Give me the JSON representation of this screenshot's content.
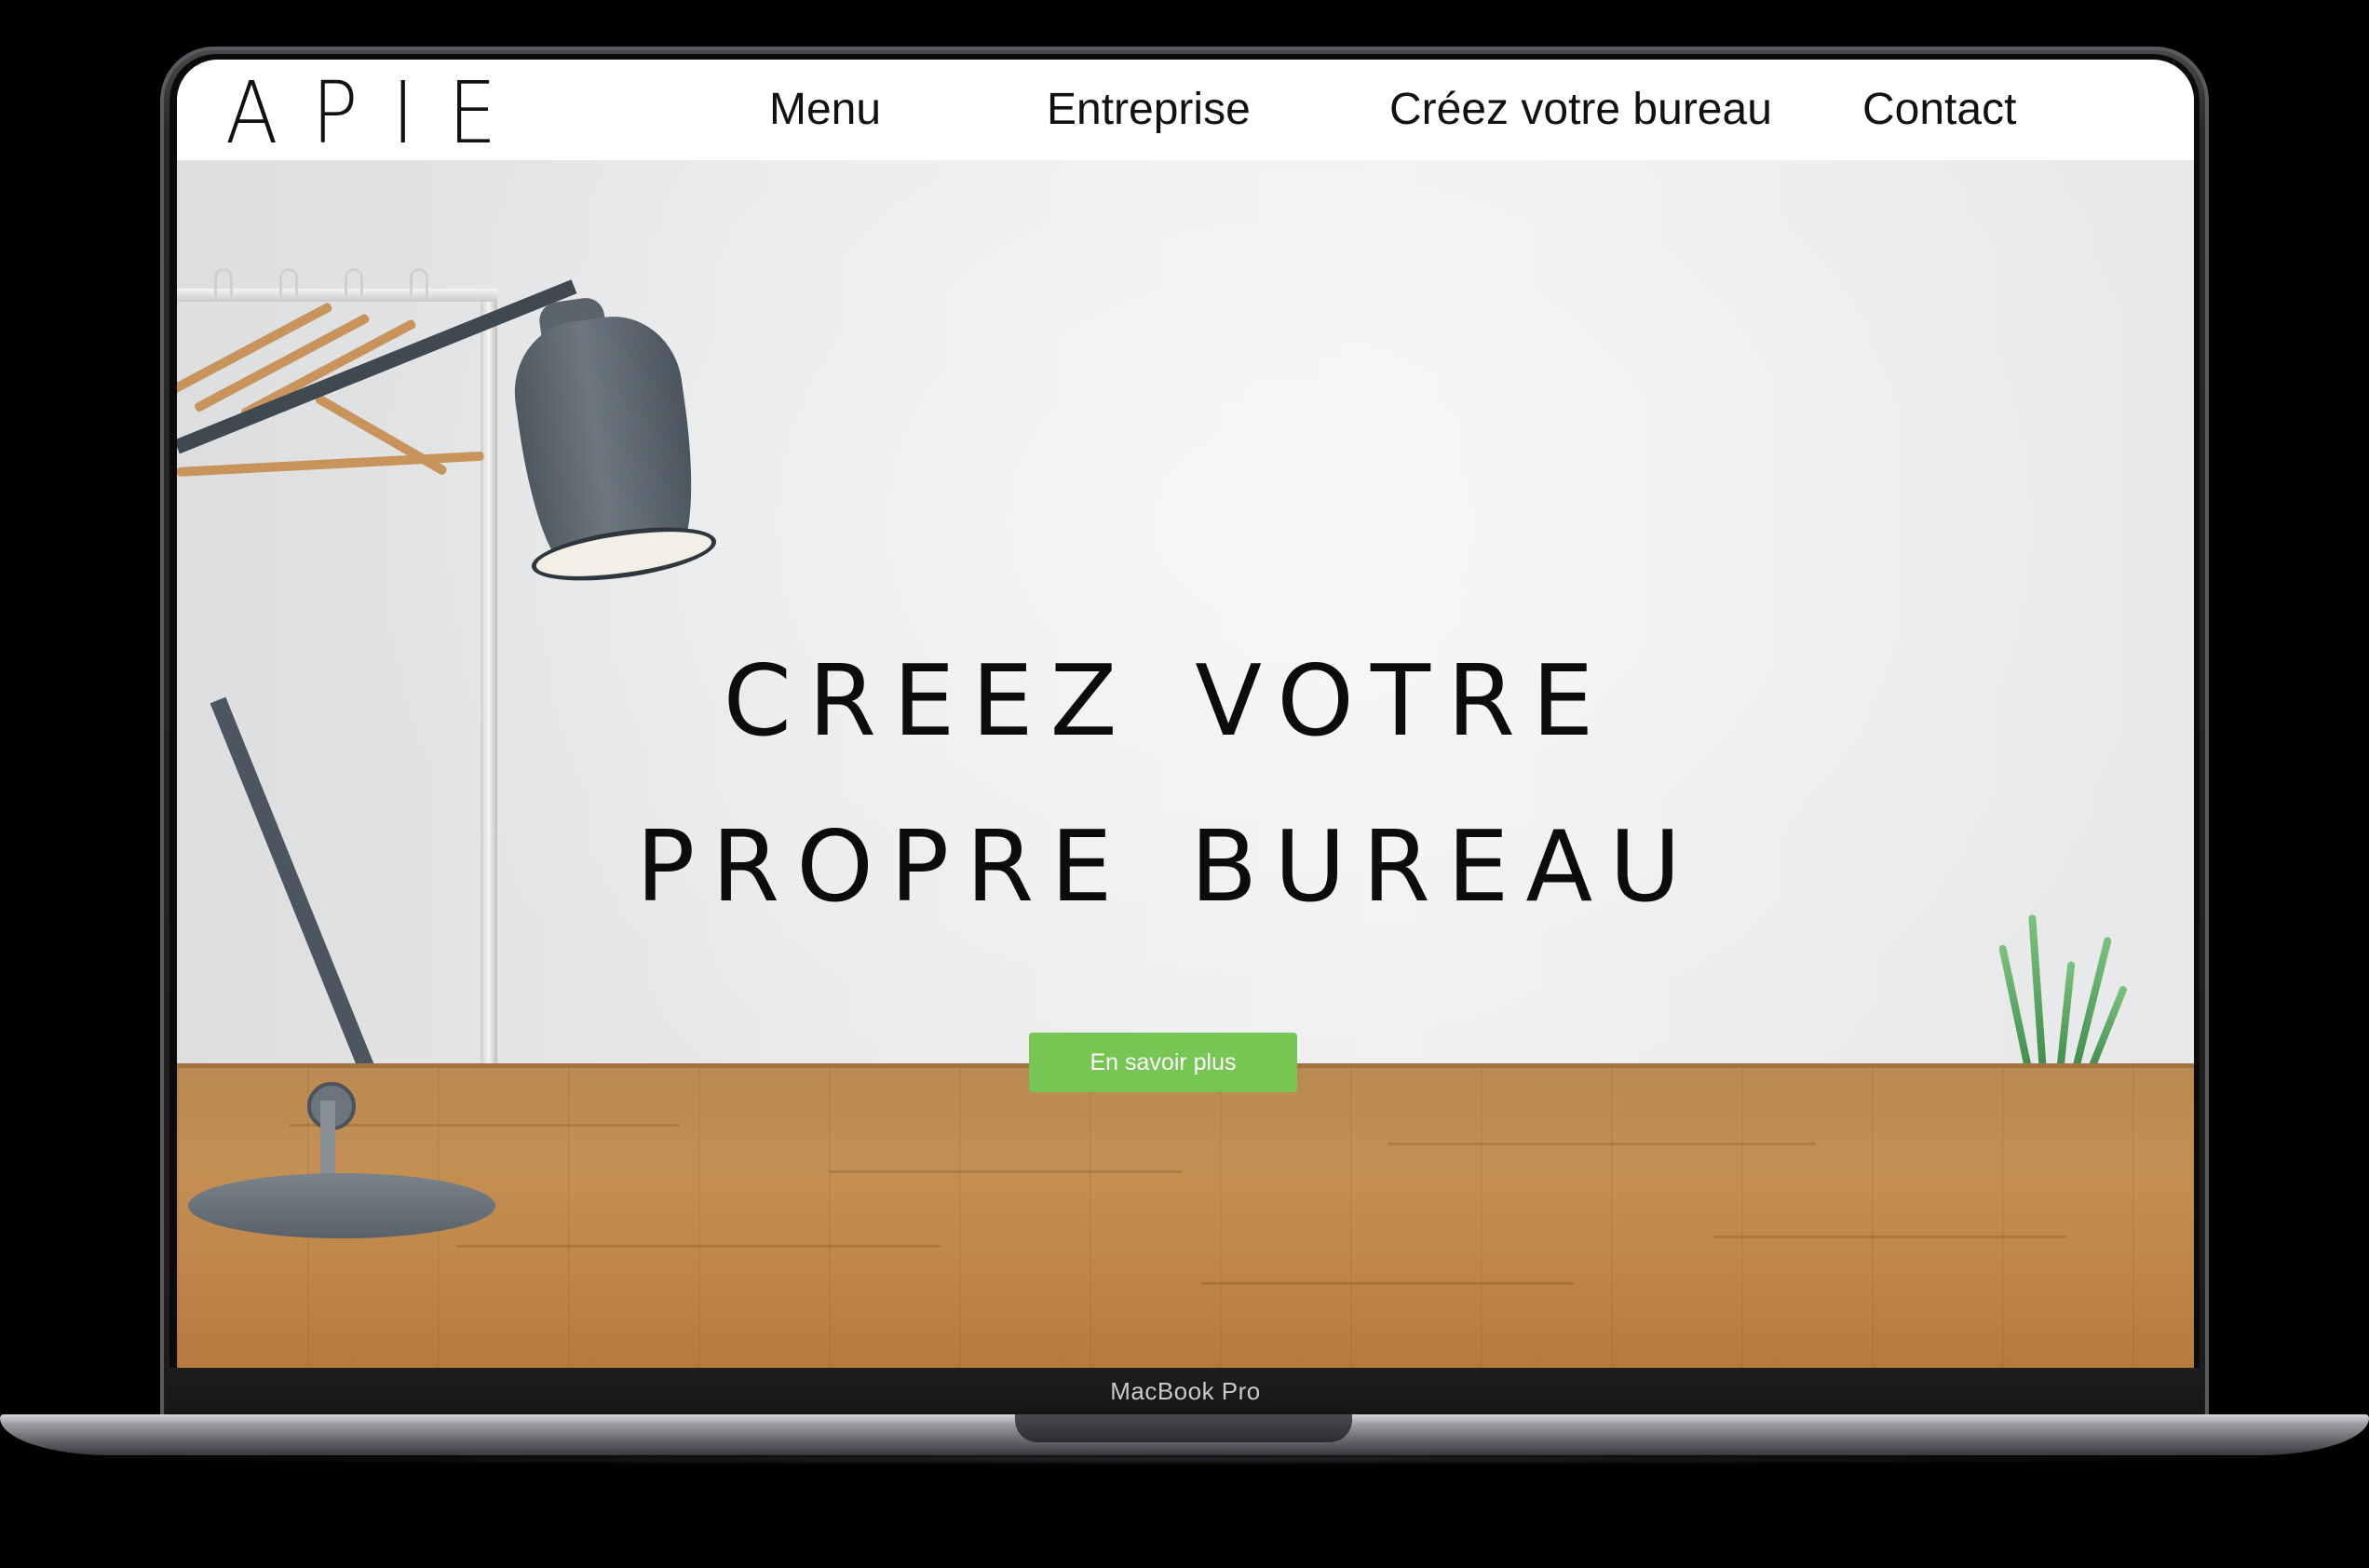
{
  "brand": {
    "logo_text": "APIE"
  },
  "nav": {
    "items": [
      {
        "label": "Menu"
      },
      {
        "label": "Entreprise"
      },
      {
        "label": "Créez votre bureau"
      },
      {
        "label": "Contact"
      }
    ]
  },
  "hero": {
    "title_line_1": "Creez votre",
    "title_line_2": "propre bureau",
    "cta_label": "En savoir plus"
  },
  "device": {
    "label": "MacBook Pro"
  },
  "colors": {
    "accent": "#77c653",
    "navbar_bg": "#ffffff",
    "text": "#111111"
  }
}
